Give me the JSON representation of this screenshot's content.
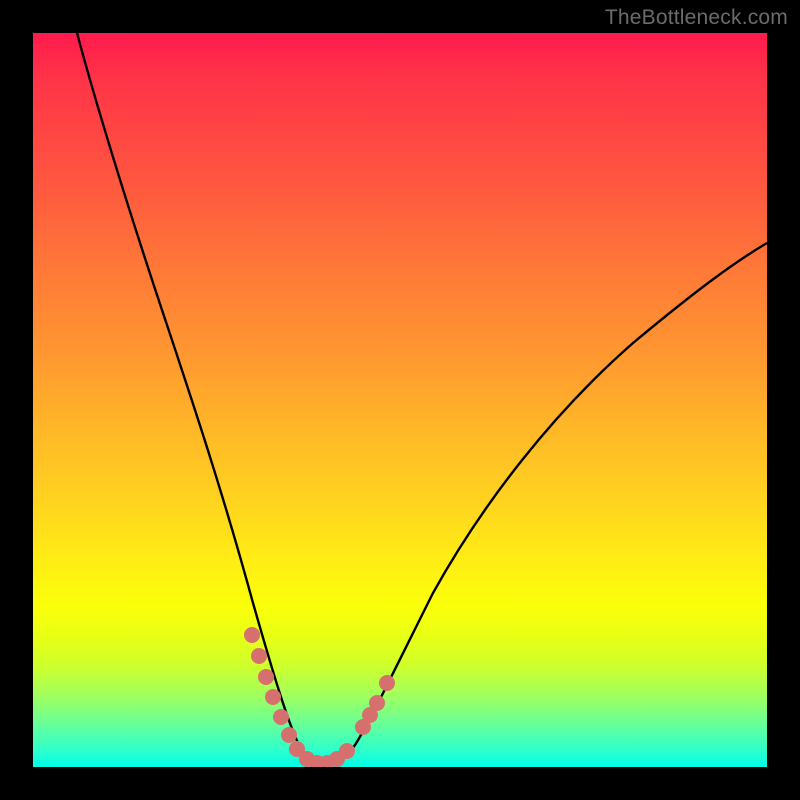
{
  "watermark": "TheBottleneck.com",
  "colors": {
    "frame": "#000000",
    "curve": "#000000",
    "marker": "#d6706f",
    "gradient_top": "#ff1a4d",
    "gradient_bottom": "#00ffe8"
  },
  "chart_data": {
    "type": "line",
    "title": "",
    "xlabel": "",
    "ylabel": "",
    "xlim": [
      0,
      100
    ],
    "ylim": [
      0,
      100
    ],
    "grid": false,
    "series": [
      {
        "name": "bottleneck-curve",
        "x": [
          6,
          10,
          14,
          18,
          22,
          26,
          28,
          30,
          32,
          33,
          34,
          36,
          38,
          40,
          42,
          44,
          48,
          52,
          58,
          66,
          74,
          82,
          90,
          100
        ],
        "y": [
          100,
          88,
          76,
          64,
          50,
          35,
          26,
          17,
          9,
          6,
          4,
          2,
          1,
          1,
          1,
          2,
          6,
          12,
          20,
          30,
          40,
          49,
          56,
          62
        ]
      }
    ],
    "markers": {
      "name": "highlight-points",
      "x": [
        29,
        30,
        31,
        32,
        34,
        36,
        38,
        40,
        42,
        43,
        44,
        45,
        46,
        47
      ],
      "y": [
        20,
        15,
        11,
        8,
        4,
        2,
        1,
        1,
        1,
        2,
        3,
        4,
        5,
        7
      ]
    }
  }
}
